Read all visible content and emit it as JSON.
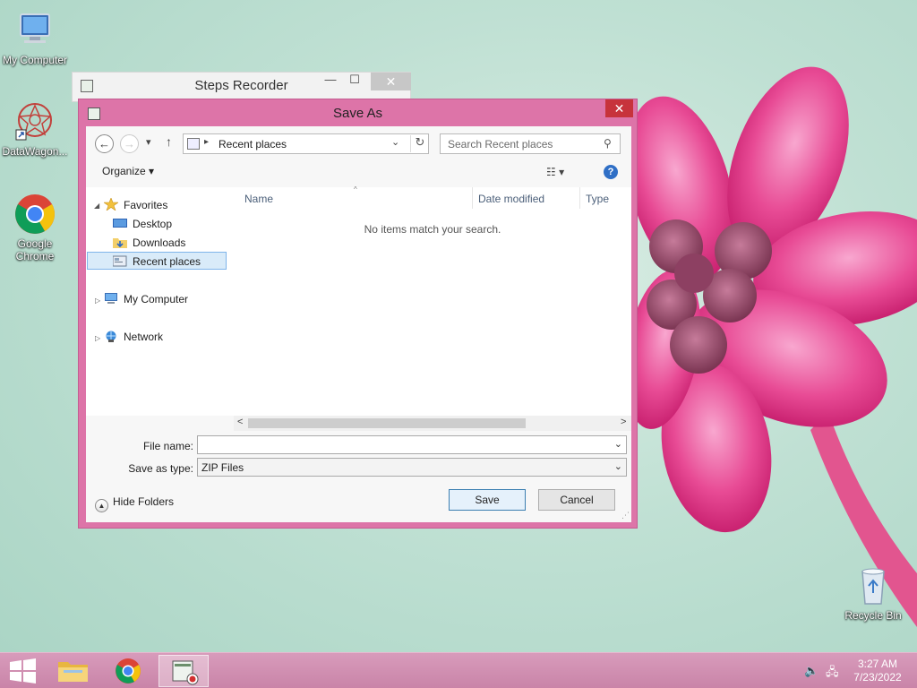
{
  "desktop": {
    "icons": [
      {
        "label": "My Computer",
        "icon": "computer-icon"
      },
      {
        "label": "DataWagon...",
        "icon": "datawagon-icon"
      },
      {
        "label": "Google Chrome",
        "icon": "chrome-icon"
      },
      {
        "label": "Recycle Bin",
        "icon": "recycle-bin-icon"
      }
    ]
  },
  "steps_recorder": {
    "title": "Steps Recorder",
    "minimize": "—",
    "maximize": "☐",
    "close": "✕"
  },
  "dialog": {
    "title": "Save As",
    "close": "✕",
    "address": {
      "path": "Recent places",
      "separator": "▸",
      "dropdown": "⌄",
      "refresh": "↻"
    },
    "nav": {
      "back": "←",
      "forward": "→",
      "history": "▾",
      "up": "↑"
    },
    "search": {
      "placeholder": "Search Recent places",
      "icon": "search-icon",
      "glyph": "⚲"
    },
    "toolbar": {
      "organize": "Organize ▾",
      "views": "☷ ▾",
      "help": "?"
    },
    "tree": {
      "favorites": "Favorites",
      "desktop": "Desktop",
      "downloads": "Downloads",
      "recent_places": "Recent places",
      "my_computer": "My Computer",
      "network": "Network"
    },
    "columns": {
      "name": "Name",
      "date_modified": "Date modified",
      "type": "Type"
    },
    "empty_message": "No items match your search.",
    "scroll": {
      "left": "<",
      "right": ">"
    },
    "file_name": {
      "label": "File name:",
      "value": ""
    },
    "save_as_type": {
      "label": "Save as type:",
      "value": "ZIP Files"
    },
    "hide_folders": "Hide Folders",
    "save": "Save",
    "cancel": "Cancel"
  },
  "taskbar": {
    "time": "3:27 AM",
    "date": "7/23/2022",
    "items": [
      "start-button",
      "file-explorer",
      "chrome",
      "steps-recorder"
    ]
  },
  "colors": {
    "dialog_frame": "#dd74a8",
    "taskbar": "#c984a8",
    "close_red": "#c7333b",
    "selection": "#d9ebf9"
  }
}
